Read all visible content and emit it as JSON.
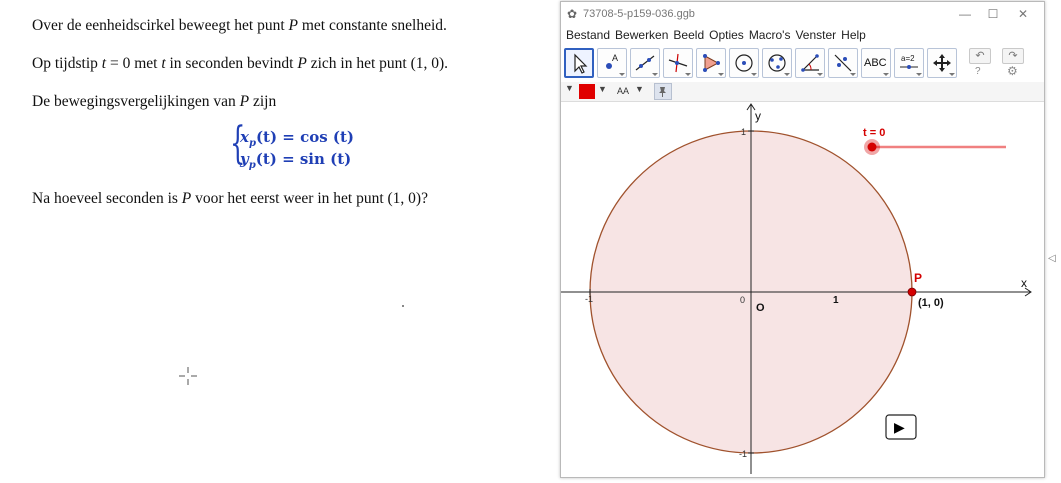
{
  "document": {
    "line1": {
      "before": "Over de eenheidscirkel beweegt het punt ",
      "var": "P",
      "after": " met constante snelheid."
    },
    "line2": {
      "before": "Op tijdstip ",
      "var_t": "t",
      "eq": " = 0 met ",
      "var_t2": "t",
      "middle": " in seconden bevindt ",
      "var_p": "P",
      "after": " zich in het punt (1, 0)."
    },
    "line3": {
      "before": "De bewegingsvergelijkingen van ",
      "var": "P",
      "after": " zijn"
    },
    "equations": {
      "x_var": "x",
      "x_sub": "p",
      "x_rest": "(t) = cos (t)",
      "y_var": "y",
      "y_sub": "p",
      "y_rest": "(t) = sin (t)"
    },
    "line4": {
      "before": "Na hoeveel seconden is ",
      "var": "P",
      "after": " voor het eerst weer in het punt (1, 0)?"
    }
  },
  "geogebra": {
    "window_title": "73708-5-p159-036.ggb",
    "window_buttons": {
      "minimize": "—",
      "maximize": "☐",
      "close": "✕"
    },
    "menu": [
      "Bestand",
      "Bewerken",
      "Beeld",
      "Opties",
      "Macro's",
      "Venster",
      "Help"
    ],
    "tools": [
      {
        "name": "move-tool",
        "active": true
      },
      {
        "name": "point-tool"
      },
      {
        "name": "line-tool"
      },
      {
        "name": "perpendicular-tool"
      },
      {
        "name": "polygon-tool"
      },
      {
        "name": "circle-tool"
      },
      {
        "name": "circle-three-points-tool"
      },
      {
        "name": "angle-tool"
      },
      {
        "name": "reflect-tool"
      },
      {
        "name": "text-tool",
        "label": "ABC"
      },
      {
        "name": "slider-tool",
        "label": "a=2"
      },
      {
        "name": "move-graphics-tool"
      }
    ],
    "undo_symbol": "↶",
    "redo_symbol": "↷",
    "help_symbol": "?",
    "settings_symbol": "⚙",
    "stylebar": {
      "color": "#e00000",
      "text_size_label": "AA"
    },
    "graph": {
      "x_label": "x",
      "y_label": "y",
      "origin_label": "O",
      "zero_label": "0",
      "tick_1_x": "1",
      "tick_neg1_x": "-1",
      "tick_1_y": "1",
      "tick_neg1_y": "-1",
      "point_label": "P",
      "point_coord_label": "(1, 0)",
      "slider_label": "t = 0",
      "slider_value": 0,
      "circle_fill": "#f7e4e4",
      "circle_stroke": "#a0522d",
      "point_color": "#d40000",
      "slider_color": "#f08080",
      "play_symbol": "▶"
    }
  }
}
